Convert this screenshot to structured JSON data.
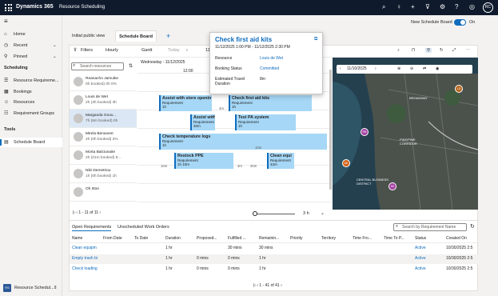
{
  "topbar": {
    "brand": "Dynamics 365",
    "app": "Resource Scheduling",
    "user_initials": "RC"
  },
  "sidebar": {
    "items": [
      {
        "label": "Home"
      },
      {
        "label": "Recent"
      },
      {
        "label": "Pinned"
      }
    ],
    "group_scheduling": "Scheduling",
    "scheduling_items": [
      {
        "label": "Resource Requireme..."
      },
      {
        "label": "Bookings"
      },
      {
        "label": "Resources"
      },
      {
        "label": "Requirement Groups"
      }
    ],
    "group_tools": "Tools",
    "tools_items": [
      {
        "label": "Schedule Board"
      }
    ],
    "area": {
      "badge": "RS",
      "label": "Resource Schedul..."
    }
  },
  "tabs": {
    "initial": "Initial public view",
    "board": "Schedule Board",
    "add": "+"
  },
  "new_board": {
    "label": "New Schedule Board",
    "state": "On"
  },
  "toolbar": {
    "filters": "Filters",
    "hourly": "Hourly",
    "gantt": "Gantt",
    "today": "Today",
    "date_short": "11/"
  },
  "resources": {
    "search_placeholder": "Search resources",
    "rows": [
      {
        "name": "Reanacho Jamuike",
        "sub": "0h booked) 0h 0%"
      },
      {
        "name": "Louis de Wet",
        "sub": "2h (3h booked) 3h"
      },
      {
        "name": "Marganda Gouv...",
        "sub": "7h (8m booked) 0h"
      },
      {
        "name": "Mirela Benavent",
        "sub": "2h (0h booked) 2%"
      },
      {
        "name": "Morta Balciunaite",
        "sub": "2h (01m booked) 8..."
      },
      {
        "name": "Niki Demetriou",
        "sub": "1h (0h booked) 1h"
      },
      {
        "name": "Oh Itton",
        "sub": ""
      }
    ],
    "pagination": "1 - 11 of 11"
  },
  "gantt": {
    "date_label": "Wednesday - 11/12/2025",
    "time_label": "12:00",
    "bookings": [
      {
        "title": "Assist with store openin",
        "sub": "Requirement",
        "dur": "1h"
      },
      {
        "title": "Check first aid kits",
        "sub": "Requirement",
        "dur": "1h"
      },
      {
        "title": "Assist with",
        "sub": "Requirement",
        "dur": "30m"
      },
      {
        "title": "Test PA system",
        "sub": "Requirement",
        "dur": "1h"
      },
      {
        "title": "Check temperature logs",
        "sub": "Requirement",
        "dur": "1h"
      },
      {
        "title": "Restock PPE",
        "sub": "Requirement",
        "dur": "1h 10m"
      },
      {
        "title": "Clean equi",
        "sub": "Requirement",
        "dur": "42m"
      }
    ],
    "travel": [
      "4m",
      "10m",
      "3m",
      "30m",
      "10m"
    ],
    "zoom_value": "3 h"
  },
  "map": {
    "date": "11/10/2025",
    "labels": [
      "BROADWAY",
      "PIKE/PINE CORRIDOR",
      "CENTRAL BUSINESS DISTRICT"
    ],
    "pins": [
      "LD",
      "RB",
      "AK",
      "MI"
    ]
  },
  "popup": {
    "title": "Check first aid kits",
    "when": "11/12/2025 1:00 PM - 11/12/2025 2:30 PM",
    "resource_label": "Resource",
    "resource_value": "Louis de Wet",
    "status_label": "Booking Status",
    "status_value": "Committed",
    "travel_label": "Estimated Travel Duration",
    "travel_value": "8m"
  },
  "requirements": {
    "tabs": [
      "Open Requirements",
      "Unscheduled Work Orders"
    ],
    "search_placeholder": "Search by Requirement Name",
    "columns": [
      "Name",
      "From Date",
      "To Date",
      "Duration",
      "Proposed...",
      "Fulfilled ...",
      "Remainin...",
      "Priority",
      "Territory",
      "Time Fro...",
      "Time To P...",
      "Status",
      "Created On"
    ],
    "rows": [
      {
        "name": "Clean equipm",
        "duration": "1 hr",
        "proposed": "",
        "fulfilled": "30 mins",
        "remaining": "30 mins",
        "status": "Active",
        "created": "10/30/2025 2:5"
      },
      {
        "name": "Empty trash bi",
        "duration": "1 hr",
        "proposed": "0 mins",
        "fulfilled": "0 mins",
        "remaining": "1 hr",
        "status": "Active",
        "created": "10/30/2025 2:5"
      },
      {
        "name": "Check loading",
        "duration": "1 hr",
        "proposed": "0 mins",
        "fulfilled": "0 mins",
        "remaining": "1 hr",
        "status": "Active",
        "created": "10/30/2025 2:5"
      }
    ],
    "pagination": "1 - 41 of 41"
  }
}
